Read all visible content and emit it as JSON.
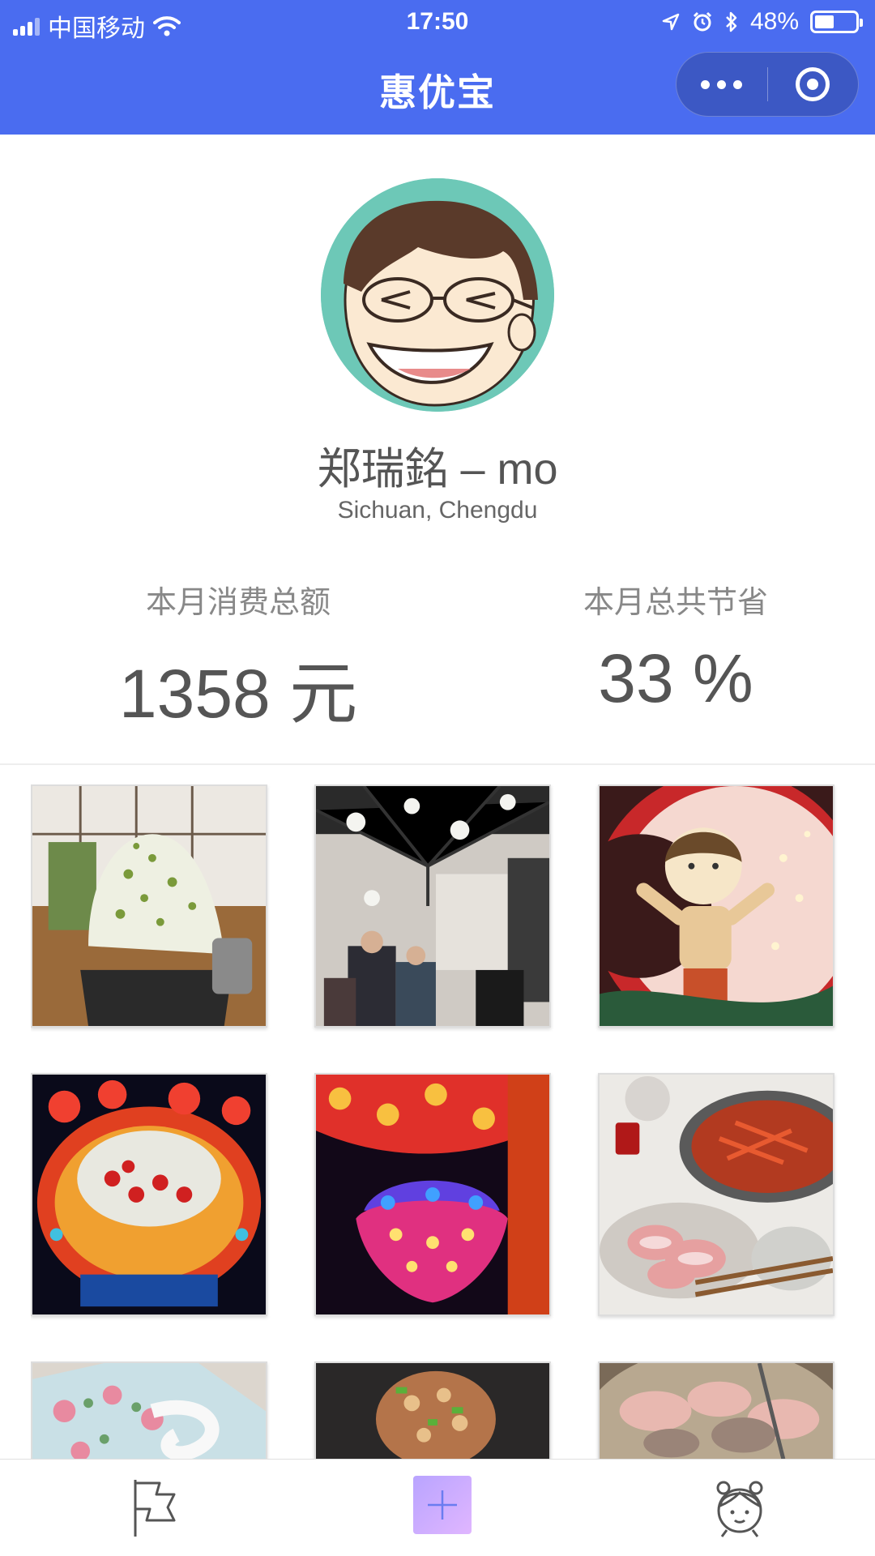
{
  "status_bar": {
    "carrier": "中国移动",
    "time": "17:50",
    "battery": "48%",
    "battery_level": 0.48
  },
  "nav": {
    "title": "惠优宝"
  },
  "profile": {
    "name": "郑瑞銘 – mo",
    "location": "Sichuan, Chengdu"
  },
  "stats": {
    "spend_label": "本月消费总额",
    "spend_value": "1358 元",
    "save_label": "本月总共节省",
    "save_value": "33 %"
  },
  "photos": [
    {
      "subject": "matcha shaved ice"
    },
    {
      "subject": "store interior crowd"
    },
    {
      "subject": "lantern girl"
    },
    {
      "subject": "festival lantern"
    },
    {
      "subject": "colorful lantern flower"
    },
    {
      "subject": "hot pot meal"
    },
    {
      "subject": "floral teacup"
    },
    {
      "subject": "topped dish"
    },
    {
      "subject": "grilled meat"
    }
  ],
  "tabbar": {
    "items": [
      {
        "icon": "flag-icon"
      },
      {
        "icon": "plus-icon"
      },
      {
        "icon": "girl-face-icon"
      }
    ]
  },
  "colors": {
    "primary": "#4a6cf0",
    "avatar_bg": "#6dc8b7",
    "add_button": "#c9aaff"
  }
}
